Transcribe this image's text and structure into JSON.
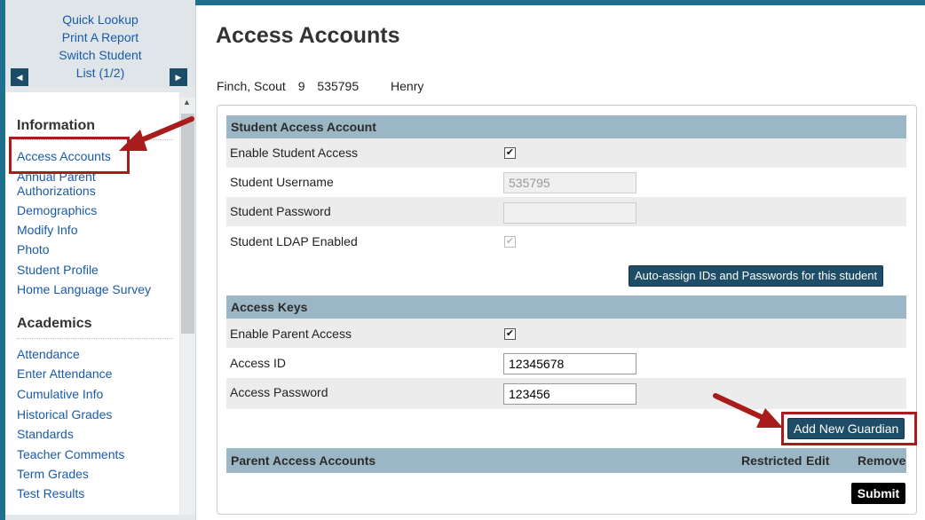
{
  "sidebar": {
    "nav": {
      "quick_lookup": "Quick Lookup",
      "print_report": "Print A Report",
      "switch_student": "Switch Student",
      "list": "List (1/2)"
    },
    "sections": [
      {
        "title": "Information",
        "items": [
          "Access Accounts",
          "Annual Parent Authorizations",
          "Demographics",
          "Modify Info",
          "Photo",
          "Student Profile",
          "Home Language Survey"
        ]
      },
      {
        "title": "Academics",
        "items": [
          "Attendance",
          "Enter Attendance",
          "Cumulative Info",
          "Historical Grades",
          "Standards",
          "Teacher Comments",
          "Term Grades",
          "Test Results"
        ]
      }
    ]
  },
  "page": {
    "title": "Access Accounts",
    "student": {
      "name": "Finch, Scout",
      "grade": "9",
      "id": "535795",
      "school": "Henry"
    }
  },
  "student_access": {
    "header": "Student Access Account",
    "enable_label": "Enable Student Access",
    "enable_checked": true,
    "username_label": "Student Username",
    "username_value": "535795",
    "password_label": "Student Password",
    "password_value": "",
    "ldap_label": "Student LDAP Enabled",
    "ldap_checked": true,
    "auto_assign_button": "Auto-assign IDs and Passwords for this student"
  },
  "access_keys": {
    "header": "Access Keys",
    "enable_parent_label": "Enable Parent Access",
    "enable_parent_checked": true,
    "access_id_label": "Access ID",
    "access_id_value": "12345678",
    "access_password_label": "Access Password",
    "access_password_value": "123456",
    "add_guardian_button": "Add New Guardian"
  },
  "parent_accounts": {
    "header": "Parent Access Accounts",
    "columns": [
      "Restricted",
      "Edit",
      "Remove"
    ],
    "submit_button": "Submit"
  },
  "colors": {
    "accent": "#1f6f8e",
    "header_bg": "#9bb7c5",
    "button_bg": "#1e4d67",
    "highlight": "#a81c1c",
    "link": "#1a5aa8"
  }
}
